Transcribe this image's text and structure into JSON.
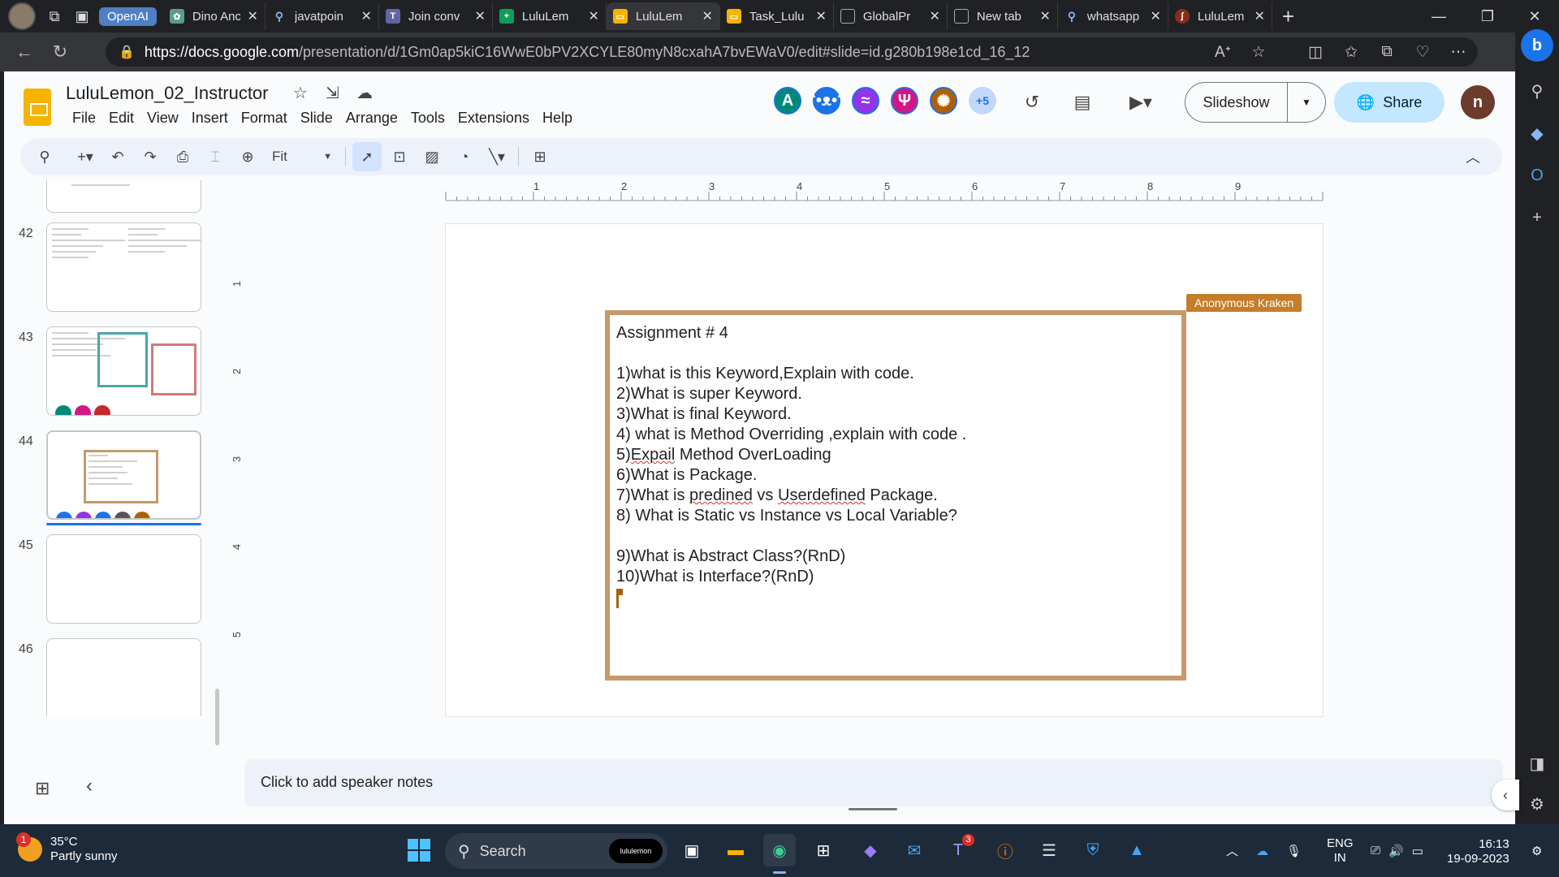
{
  "browser": {
    "tab_group_label": "OpenAI",
    "tabs": [
      {
        "label": "Dino Anc",
        "icon": "chatgpt-icon",
        "color": "#5a9e8a"
      },
      {
        "label": "javatpoin",
        "icon": "search-icon",
        "color": "#202124"
      },
      {
        "label": "Join conv",
        "icon": "teams-icon",
        "color": "#6264a7"
      },
      {
        "label": "LuluLem",
        "icon": "sheets-icon",
        "color": "#0f9d58"
      },
      {
        "label": "LuluLem",
        "icon": "slides-icon",
        "color": "#f4b400",
        "active": true
      },
      {
        "label": "Task_Lulu",
        "icon": "slides-icon",
        "color": "#f4b400"
      },
      {
        "label": "GlobalPr",
        "icon": "document-icon",
        "color": "#202124"
      },
      {
        "label": "New tab",
        "icon": "newtab-icon",
        "color": "#202124"
      },
      {
        "label": "whatsapp",
        "icon": "search-icon",
        "color": "#202124"
      },
      {
        "label": "LuluLem",
        "icon": "lululemon-icon",
        "color": "#8b2c1a"
      }
    ],
    "url_host": "https://docs.google.com",
    "url_path": "/presentation/d/1Gm0ap5kiC16WwE0bPV2XCYLE80myN8cxahA7bvEWaV0/edit#slide=id.g280b198e1cd_16_12"
  },
  "app": {
    "title": "LuluLemon_02_Instructor",
    "menu": [
      "File",
      "Edit",
      "View",
      "Insert",
      "Format",
      "Slide",
      "Arrange",
      "Tools",
      "Extensions",
      "Help"
    ],
    "collaborators": [
      {
        "label": "A",
        "color": "#00897b"
      },
      {
        "label": "",
        "icon": "bear-icon",
        "color": "#1a73e8"
      },
      {
        "label": "",
        "icon": "dolphin-icon",
        "color": "#9334e6"
      },
      {
        "label": "",
        "icon": "rabbit-icon",
        "color": "#d01884"
      },
      {
        "label": "",
        "icon": "squid-icon",
        "color": "#b06000"
      }
    ],
    "more_collaborators": "+5",
    "slideshow_label": "Slideshow",
    "share_label": "Share",
    "user_initial": "n"
  },
  "toolbar": {
    "zoom": "Fit"
  },
  "filmstrip": {
    "slides": [
      {
        "number": "",
        "type": "code"
      },
      {
        "number": "42",
        "type": "code"
      },
      {
        "number": "43",
        "type": "code-boxes"
      },
      {
        "number": "44",
        "type": "assignment",
        "selected": true
      },
      {
        "number": "45",
        "type": "blank"
      },
      {
        "number": "46",
        "type": "blank"
      }
    ]
  },
  "rulers": {
    "horizontal": [
      "1",
      "2",
      "3",
      "4",
      "5",
      "6",
      "7",
      "8",
      "9"
    ],
    "vertical": [
      "1",
      "2",
      "3",
      "4",
      "5"
    ]
  },
  "slide": {
    "collaborator_tag": "Anonymous Kraken",
    "border_color": "#c49a6c",
    "lines": {
      "title": "Assignment # 4",
      "q1": "1)what is this Keyword,Explain with code.",
      "q2": "2)What is super Keyword.",
      "q3": "3)What is final Keyword.",
      "q4": "4) what is Method Overriding ,explain with code .",
      "q5a": "5)",
      "q5b": "Expail",
      "q5c": " Method OverLoading",
      "q6": "6)What is Package.",
      "q7a": "7)What is ",
      "q7b": "predined",
      "q7c": " vs ",
      "q7d": "Userdefined",
      "q7e": " Package.",
      "q8": "8) What is Static vs Instance vs Local Variable?",
      "q9": "9)What is Abstract Class?(RnD)",
      "q10": "10)What is Interface?(RnD)"
    }
  },
  "notes": {
    "placeholder": "Click to add speaker notes"
  },
  "taskbar": {
    "weather_badge": "1",
    "temperature": "35°C",
    "condition": "Partly sunny",
    "search_label": "Search",
    "search_pill": "lululemon",
    "teams_count": "3",
    "language": "ENG",
    "region": "IN",
    "time": "16:13",
    "date": "19-09-2023"
  }
}
